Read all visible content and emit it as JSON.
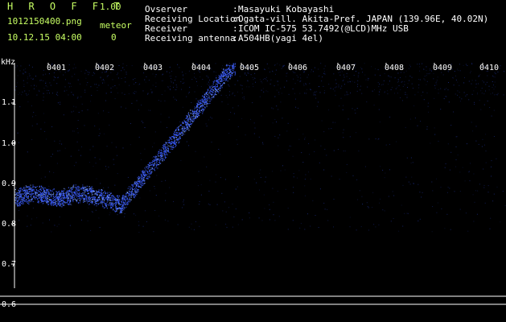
{
  "header": {
    "app_title": "H R O F F T",
    "version": "1.00",
    "filename": "1012150400.png",
    "datetime": "10.12.15 04:00",
    "meteor_label": "meteor",
    "meteor_count": "0"
  },
  "info": [
    {
      "label": "Ovserver",
      "value": "Masayuki Kobayashi"
    },
    {
      "label": "Receiving Location",
      "value": "Ogata-vill. Akita-Pref. JAPAN (139.96E, 40.02N)"
    },
    {
      "label": "Receiver",
      "value": "ICOM IC-575 53.7492(@LCD)MHz USB"
    },
    {
      "label": "Receiving antenna",
      "value": "A504HB(yagi 4el)"
    }
  ],
  "axes": {
    "y_unit": "kHz",
    "y_ticks": [
      "1.1",
      "1.0",
      "0.9",
      "0.8",
      "0.7",
      "0.6"
    ],
    "x_ticks": [
      "0401",
      "0402",
      "0403",
      "0404",
      "0405",
      "0406",
      "0407",
      "0408",
      "0409",
      "0410"
    ]
  },
  "colors": {
    "background": "#000000",
    "header_accent": "#c8ff64",
    "signal": "#3a5cff",
    "noise": "#1a2a7a",
    "grid": "#ffffff"
  }
}
